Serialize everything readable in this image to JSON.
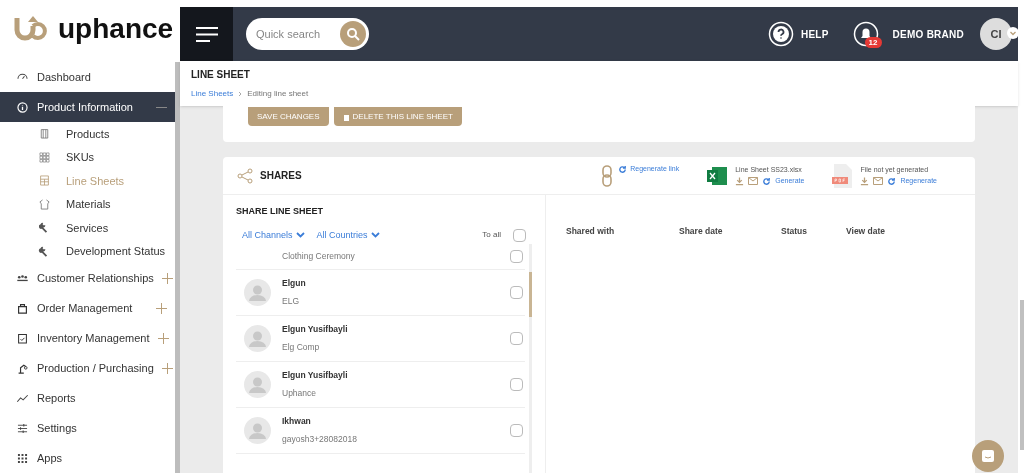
{
  "logo": {
    "text": "uphance"
  },
  "header": {
    "search": {
      "placeholder": "Quick search"
    },
    "help": "HELP",
    "notifications": {
      "count": "12"
    },
    "brand": "DEMO BRAND",
    "avatar": "CI"
  },
  "sidebar": {
    "items": [
      {
        "label": "Dashboard",
        "kind": "link",
        "selected": false
      },
      {
        "label": "Product Information",
        "kind": "group",
        "selected": true,
        "expanded": true,
        "children": [
          {
            "label": "Products",
            "selected": false
          },
          {
            "label": "SKUs",
            "selected": false
          },
          {
            "label": "Line Sheets",
            "selected": true
          },
          {
            "label": "Materials",
            "selected": false
          },
          {
            "label": "Services",
            "selected": false
          },
          {
            "label": "Development Status",
            "selected": false
          }
        ]
      },
      {
        "label": "Customer Relationships",
        "kind": "group",
        "selected": false,
        "expanded": false
      },
      {
        "label": "Order Management",
        "kind": "group",
        "selected": false,
        "expanded": false
      },
      {
        "label": "Inventory Management",
        "kind": "group",
        "selected": false,
        "expanded": false
      },
      {
        "label": "Production / Purchasing",
        "kind": "group",
        "selected": false,
        "expanded": false
      },
      {
        "label": "Reports",
        "kind": "link",
        "selected": false
      },
      {
        "label": "Settings",
        "kind": "link",
        "selected": false
      },
      {
        "label": "Apps",
        "kind": "link",
        "selected": false
      }
    ]
  },
  "page": {
    "title": "LINE SHEET",
    "breadcrumb": [
      {
        "label": "Line Sheets",
        "kind": "link"
      },
      {
        "label": "Editing line sheet",
        "kind": "current"
      }
    ],
    "buttons": [
      {
        "label": "SAVE CHANGES",
        "kind": "save"
      },
      {
        "label": "DELETE THIS LINE SHEET",
        "kind": "delete"
      }
    ]
  },
  "shares": {
    "title": "SHARES",
    "link": {
      "action": "Regenerate link"
    },
    "files": [
      {
        "kind": "xlsx",
        "name": "Line Sheet SS23.xlsx",
        "action": "Generate"
      },
      {
        "kind": "pdf",
        "name": "File not yet generated",
        "action": "Regenerate"
      }
    ],
    "share_panel": {
      "title": "SHARE LINE SHEET",
      "filters": [
        "All Channels",
        "All Countries"
      ],
      "to_all": {
        "label": "To all",
        "checked": false
      },
      "contacts": [
        {
          "company": "Clothing Ceremony",
          "checked": false
        },
        {
          "name": "Elgun",
          "company": "ELG",
          "checked": false
        },
        {
          "name": "Elgun Yusifbayli",
          "company": "Elg Comp",
          "checked": false
        },
        {
          "name": "Elgun Yusifbayli",
          "company": "Uphance",
          "checked": false
        },
        {
          "name": "Ikhwan",
          "company": "gayosh3+28082018",
          "checked": false
        }
      ]
    },
    "table": {
      "columns": [
        "Shared with",
        "Share date",
        "Status",
        "View date"
      ]
    }
  }
}
